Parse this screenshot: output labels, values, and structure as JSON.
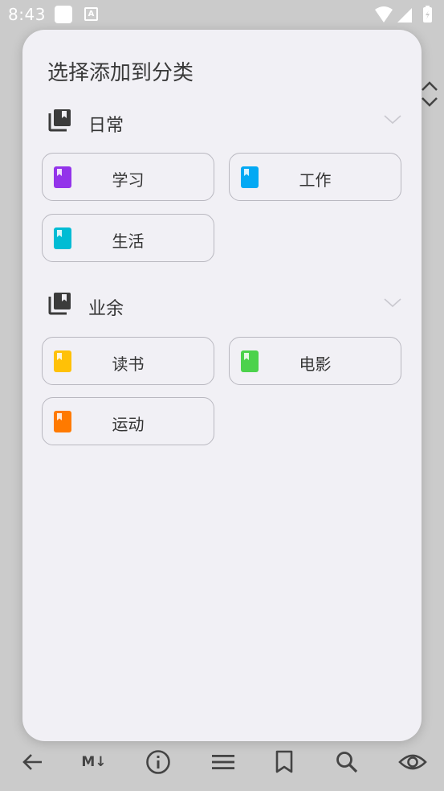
{
  "status_bar": {
    "time": "8:43"
  },
  "dialog": {
    "title": "选择添加到分类",
    "groups": [
      {
        "name": "日常",
        "items": [
          {
            "label": "学习",
            "color": "#9333ea"
          },
          {
            "label": "工作",
            "color": "#03a9f4"
          },
          {
            "label": "生活",
            "color": "#00bcd4"
          }
        ]
      },
      {
        "name": "业余",
        "items": [
          {
            "label": "读书",
            "color": "#ffc107"
          },
          {
            "label": "电影",
            "color": "#4cd24c"
          },
          {
            "label": "运动",
            "color": "#ff7a00"
          }
        ]
      }
    ]
  },
  "toolbar": {
    "markdown_label": "M↓",
    "icons": [
      "back-arrow-icon",
      "markdown-icon",
      "info-icon",
      "menu-icon",
      "bookmark-icon",
      "search-icon",
      "eye-icon"
    ]
  }
}
